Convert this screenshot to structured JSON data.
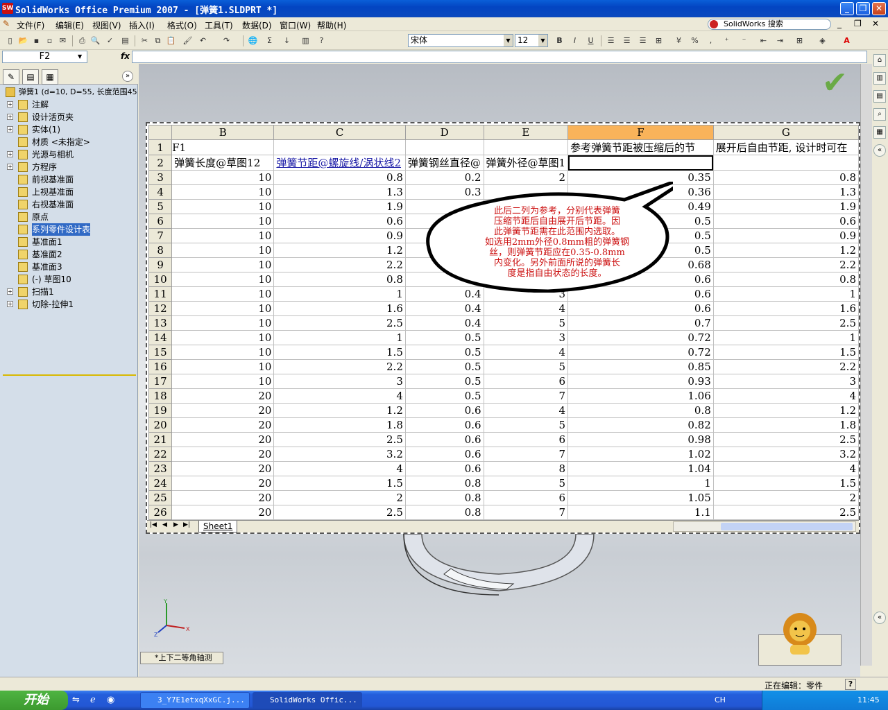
{
  "window": {
    "title": "SolidWorks Office Premium 2007 - [弹簧1.SLDPRT *]",
    "app_icon": "SW"
  },
  "menu": [
    "文件(F)",
    "编辑(E)",
    "视图(V)",
    "插入(I)",
    "格式(O)",
    "工具(T)",
    "数据(D)",
    "窗口(W)",
    "帮助(H)"
  ],
  "search": {
    "label": "SolidWorks 搜索"
  },
  "toolbar": {
    "font_name": "宋体",
    "font_size": "12",
    "bold": "B",
    "italic": "I",
    "underline": "U",
    "percent": "%",
    "comma": ",",
    "sigma": "Σ"
  },
  "formula": {
    "name_box": "F2",
    "fx": "fx",
    "value": ""
  },
  "feature_tree": {
    "root": "弹簧1    (d=10, D=55, 长度范围45",
    "items": [
      "注解",
      "设计活页夹",
      "实体(1)",
      "材质 <未指定>",
      "光源与相机",
      "方程序",
      "前视基准面",
      "上视基准面",
      "右视基准面",
      "原点",
      "系列零件设计表",
      "基准面1",
      "基准面2",
      "基准面3",
      "(-) 草图10",
      "扫描1",
      "切除-拉伸1"
    ]
  },
  "spreadsheet": {
    "columns": [
      "B",
      "C",
      "D",
      "E",
      "F",
      "G"
    ],
    "selected_column": "F",
    "row1": {
      "num": "1",
      "a": "F1",
      "f": "参考弹簧节距被压缩后的节",
      "g": "展开后自由节距, 设计时可在"
    },
    "row2": {
      "num": "2",
      "b": "弹簧长度@草图12",
      "c": "弹簧节距@螺旋线/涡状线2",
      "d": "弹簧钢丝直径@",
      "e": "弹簧外径@草图1",
      "f": ""
    },
    "rows": [
      [
        "3",
        "10",
        "0.8",
        "0.2",
        "2",
        "0.35",
        "0.8"
      ],
      [
        "4",
        "10",
        "1.3",
        "0.3",
        "",
        "0.36",
        "1.3"
      ],
      [
        "5",
        "10",
        "1.9",
        "",
        "",
        "0.49",
        "1.9"
      ],
      [
        "6",
        "10",
        "0.6",
        "",
        "",
        "0.5",
        "0.6"
      ],
      [
        "7",
        "10",
        "0.9",
        "",
        "",
        "0.5",
        "0.9"
      ],
      [
        "8",
        "10",
        "1.2",
        "",
        "",
        "0.5",
        "1.2"
      ],
      [
        "9",
        "10",
        "2.2",
        "",
        "",
        "0.68",
        "2.2"
      ],
      [
        "10",
        "10",
        "0.8",
        "",
        "",
        "0.6",
        "0.8"
      ],
      [
        "11",
        "10",
        "1",
        "0.4",
        "3",
        "0.6",
        "1"
      ],
      [
        "12",
        "10",
        "1.6",
        "0.4",
        "4",
        "0.6",
        "1.6"
      ],
      [
        "13",
        "10",
        "2.5",
        "0.4",
        "5",
        "0.7",
        "2.5"
      ],
      [
        "14",
        "10",
        "1",
        "0.5",
        "3",
        "0.72",
        "1"
      ],
      [
        "15",
        "10",
        "1.5",
        "0.5",
        "4",
        "0.72",
        "1.5"
      ],
      [
        "16",
        "10",
        "2.2",
        "0.5",
        "5",
        "0.85",
        "2.2"
      ],
      [
        "17",
        "10",
        "3",
        "0.5",
        "6",
        "0.93",
        "3"
      ],
      [
        "18",
        "20",
        "4",
        "0.5",
        "7",
        "1.06",
        "4"
      ],
      [
        "19",
        "20",
        "1.2",
        "0.6",
        "4",
        "0.8",
        "1.2"
      ],
      [
        "20",
        "20",
        "1.8",
        "0.6",
        "5",
        "0.82",
        "1.8"
      ],
      [
        "21",
        "20",
        "2.5",
        "0.6",
        "6",
        "0.98",
        "2.5"
      ],
      [
        "22",
        "20",
        "3.2",
        "0.6",
        "7",
        "1.02",
        "3.2"
      ],
      [
        "23",
        "20",
        "4",
        "0.6",
        "8",
        "1.04",
        "4"
      ],
      [
        "24",
        "20",
        "1.5",
        "0.8",
        "5",
        "1",
        "1.5"
      ],
      [
        "25",
        "20",
        "2",
        "0.8",
        "6",
        "1.05",
        "2"
      ],
      [
        "26",
        "20",
        "2.5",
        "0.8",
        "7",
        "1.1",
        "2.5"
      ]
    ],
    "sheet_tab": "Sheet1"
  },
  "annotation": {
    "lines": [
      "此后二列为参考，分别代表弹簧",
      "压缩节距后自由展开后节距。因",
      "此弹簧节距需在此范围内选取。",
      "如选用2mm外径0.8mm粗的弹簧钢",
      "丝，则弹簧节距应在0.35-0.8mm",
      "内变化。另外前面所说的弹簧长",
      "度是指自由状态的长度。"
    ],
    "color": "#cc1010"
  },
  "graphics": {
    "view_orientation": "*上下二等角轴测",
    "triad": {
      "x": "X",
      "y": "Y",
      "z": "Z"
    }
  },
  "status": {
    "editing": "正在编辑：零件",
    "help": "?"
  },
  "taskbar": {
    "start": "开始",
    "buttons": [
      "3_Y7E1etxqXxGC.j...",
      "SolidWorks Offic..."
    ],
    "lang": "CH",
    "clock": "11:45"
  },
  "colors": {
    "title_bar": "#0345c2",
    "selected_header": "#f9b35a",
    "check": "#6aaa46",
    "link": "#1a1aa6"
  }
}
